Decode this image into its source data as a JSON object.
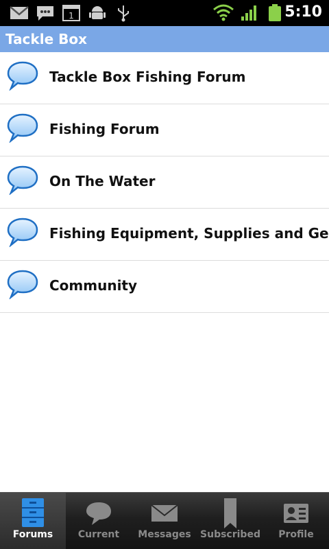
{
  "status_bar": {
    "time": "5:10",
    "icons": [
      "gmail-icon",
      "sms-icon",
      "calendar-icon",
      "android-debug-icon",
      "usb-icon",
      "wifi-icon",
      "signal-icon",
      "battery-icon"
    ],
    "calendar_day": "1"
  },
  "header": {
    "title": "Tackle Box"
  },
  "forums": [
    {
      "label": "Tackle Box Fishing Forum"
    },
    {
      "label": "Fishing Forum"
    },
    {
      "label": "On The Water"
    },
    {
      "label": "Fishing Equipment, Supplies and Gear"
    },
    {
      "label": "Community"
    }
  ],
  "tabs": [
    {
      "label": "Forums",
      "icon": "forums-cabinet-icon",
      "active": true
    },
    {
      "label": "Current",
      "icon": "current-bubble-icon",
      "active": false
    },
    {
      "label": "Messages",
      "icon": "messages-envelope-icon",
      "active": false
    },
    {
      "label": "Subscribed",
      "icon": "subscribed-bookmark-icon",
      "active": false
    },
    {
      "label": "Profile",
      "icon": "profile-card-icon",
      "active": false
    }
  ],
  "colors": {
    "title_bar": "#7aa7e6",
    "bubble": "#5aa0e8",
    "active_tab_icon": "#2f8fe6"
  }
}
